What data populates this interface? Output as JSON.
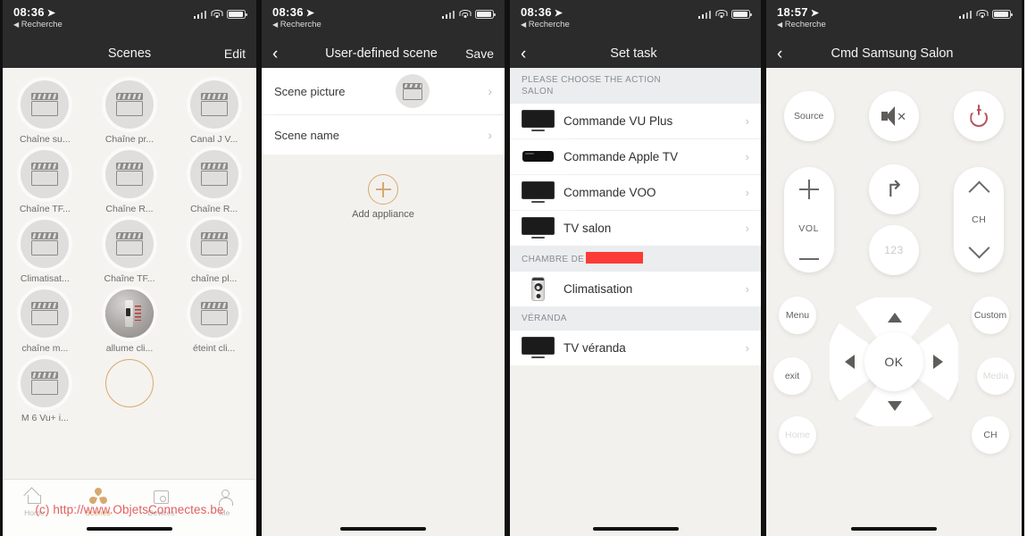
{
  "watermark": "(c) http://www.ObjetsConnectes.be",
  "screen1": {
    "status": {
      "time": "08:36",
      "back_label": "Recherche"
    },
    "nav": {
      "title": "Scenes",
      "right_action": "Edit"
    },
    "scenes": [
      {
        "label": "Chaîne su...",
        "icon": "clapperboard-icon"
      },
      {
        "label": "Chaîne pr...",
        "icon": "clapperboard-icon"
      },
      {
        "label": "Canal J V...",
        "icon": "clapperboard-icon"
      },
      {
        "label": "Chaîne TF...",
        "icon": "clapperboard-icon"
      },
      {
        "label": "Chaîne R...",
        "icon": "clapperboard-icon"
      },
      {
        "label": "Chaîne R...",
        "icon": "clapperboard-icon"
      },
      {
        "label": "Climatisat...",
        "icon": "clapperboard-icon"
      },
      {
        "label": "Chaîne TF...",
        "icon": "clapperboard-icon"
      },
      {
        "label": "chaîne pl...",
        "icon": "clapperboard-icon"
      },
      {
        "label": "chaîne m...",
        "icon": "clapperboard-icon"
      },
      {
        "label": "allume cli...",
        "icon": "ac-remote-photo"
      },
      {
        "label": "éteint cli...",
        "icon": "clapperboard-icon"
      },
      {
        "label": "M 6 Vu+ i...",
        "icon": "clapperboard-icon"
      }
    ],
    "add_scene_label": "",
    "tabs": [
      {
        "label": "Home",
        "icon": "home-icon",
        "active": false
      },
      {
        "label": "Scenes",
        "icon": "scenes-icon",
        "active": true
      },
      {
        "label": "Devices",
        "icon": "devices-icon",
        "active": false
      },
      {
        "label": "Me",
        "icon": "profile-icon",
        "active": false
      }
    ]
  },
  "screen2": {
    "status": {
      "time": "08:36",
      "back_label": "Recherche"
    },
    "nav": {
      "title": "User-defined scene",
      "right_action": "Save"
    },
    "rows": [
      {
        "label": "Scene picture",
        "type": "thumbnail"
      },
      {
        "label": "Scene name",
        "type": "text"
      }
    ],
    "add_appliance_label": "Add appliance"
  },
  "screen3": {
    "status": {
      "time": "08:36",
      "back_label": "Recherche"
    },
    "nav": {
      "title": "Set task"
    },
    "prompt_line1": "PLEASE CHOOSE THE ACTION",
    "sections": [
      {
        "title": "SALON",
        "redacted": false,
        "items": [
          {
            "label": "Commande VU Plus",
            "icon": "tv-icon"
          },
          {
            "label": "Commande Apple TV",
            "icon": "appletv-icon"
          },
          {
            "label": "Commande VOO",
            "icon": "tv-icon"
          },
          {
            "label": "TV salon",
            "icon": "tv-icon"
          }
        ]
      },
      {
        "title": "CHAMBRE DE",
        "redacted": true,
        "items": [
          {
            "label": "Climatisation",
            "icon": "ac-remote-icon"
          }
        ]
      },
      {
        "title": "VÉRANDA",
        "redacted": false,
        "items": [
          {
            "label": "TV véranda",
            "icon": "tv-icon"
          }
        ]
      }
    ]
  },
  "screen4": {
    "status": {
      "time": "18:57",
      "back_label": "Recherche"
    },
    "nav": {
      "title": "Cmd Samsung Salon"
    },
    "top_row": [
      {
        "label": "Source",
        "icon": "source-button",
        "kind": "text"
      },
      {
        "label": "",
        "icon": "mute-icon",
        "kind": "icon"
      },
      {
        "label": "",
        "icon": "power-icon",
        "kind": "icon"
      }
    ],
    "vol_label": "VOL",
    "ch_label": "CH",
    "back_icon": "back-arrow-icon",
    "numpad_label": "123",
    "ok_label": "OK",
    "side_buttons": [
      {
        "label": "Menu",
        "dim": false
      },
      {
        "label": "Custom",
        "dim": false
      },
      {
        "label": "exit",
        "dim": false
      },
      {
        "label": "Media",
        "dim": true
      },
      {
        "label": "Home",
        "dim": true
      },
      {
        "label": "CH",
        "dim": false
      }
    ],
    "colors": {
      "power": "#b5555e",
      "accent": "#d6a96f"
    }
  }
}
